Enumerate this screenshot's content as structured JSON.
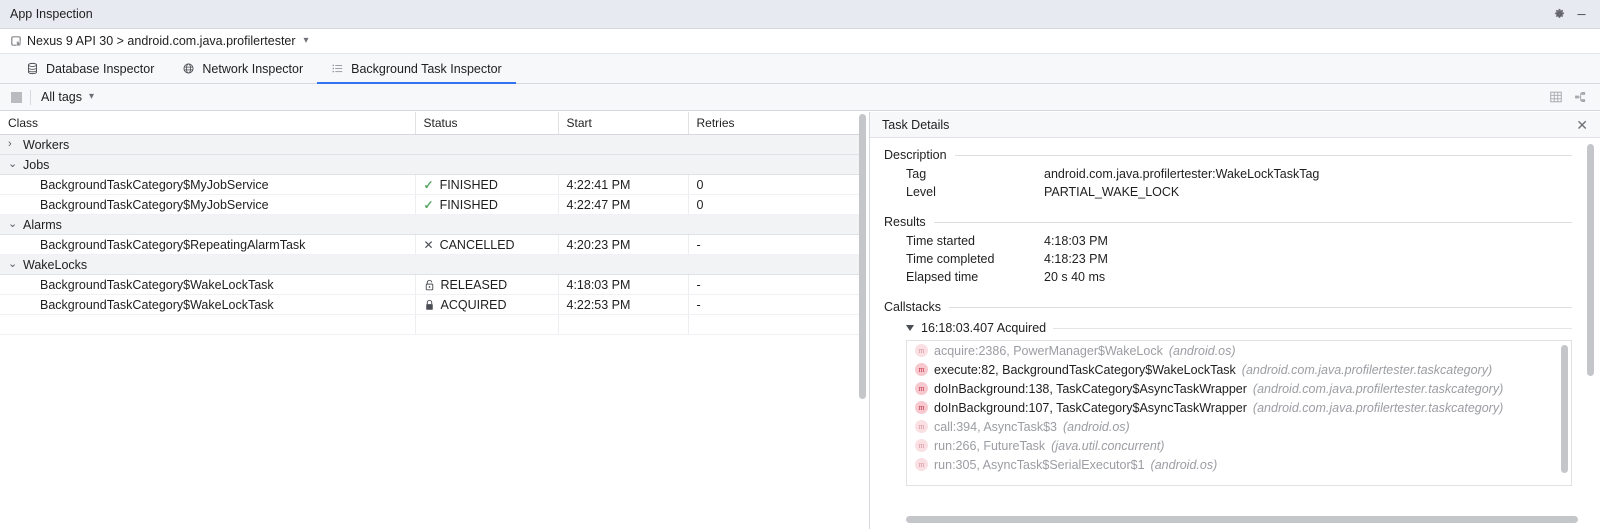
{
  "window": {
    "title": "App Inspection",
    "settings_icon": "gear-icon",
    "minimize_icon": "minimize-icon"
  },
  "device_bar": {
    "icon": "device-icon",
    "label": "Nexus 9 API 30 > android.com.java.profilertester",
    "dropdown_icon": "chevron-down-icon"
  },
  "tabs": [
    {
      "label": "Database Inspector",
      "icon": "database-icon",
      "active": false
    },
    {
      "label": "Network Inspector",
      "icon": "globe-icon",
      "active": false
    },
    {
      "label": "Background Task Inspector",
      "icon": "list-icon",
      "active": true
    }
  ],
  "toolbar": {
    "stop_button": "stop-button",
    "tags_filter_label": "All tags",
    "tags_dropdown_icon": "chevron-down-icon",
    "table_view_icon": "table-view-icon",
    "graph_view_icon": "graph-view-icon"
  },
  "table": {
    "columns": [
      "Class",
      "Status",
      "Start",
      "Retries"
    ],
    "groups": [
      {
        "name": "Workers",
        "expanded": false,
        "chevron": "›",
        "rows": []
      },
      {
        "name": "Jobs",
        "expanded": true,
        "chevron": "⌄",
        "rows": [
          {
            "class": "BackgroundTaskCategory$MyJobService",
            "status": "FINISHED",
            "status_icon": "check-icon",
            "start": "4:22:41 PM",
            "retries": "0"
          },
          {
            "class": "BackgroundTaskCategory$MyJobService",
            "status": "FINISHED",
            "status_icon": "check-icon",
            "start": "4:22:47 PM",
            "retries": "0"
          }
        ]
      },
      {
        "name": "Alarms",
        "expanded": true,
        "chevron": "⌄",
        "rows": [
          {
            "class": "BackgroundTaskCategory$RepeatingAlarmTask",
            "status": "CANCELLED",
            "status_icon": "x-icon",
            "start": "4:20:23 PM",
            "retries": "-"
          }
        ]
      },
      {
        "name": "WakeLocks",
        "expanded": true,
        "chevron": "⌄",
        "rows": [
          {
            "class": "BackgroundTaskCategory$WakeLockTask",
            "status": "RELEASED",
            "status_icon": "unlock-icon",
            "start": "4:18:03 PM",
            "retries": "-"
          },
          {
            "class": "BackgroundTaskCategory$WakeLockTask",
            "status": "ACQUIRED",
            "status_icon": "lock-icon",
            "start": "4:22:53 PM",
            "retries": "-"
          }
        ]
      }
    ]
  },
  "details": {
    "header": "Task Details",
    "close_icon": "close-icon",
    "description": {
      "title": "Description",
      "fields": [
        {
          "key": "Tag",
          "value": "android.com.java.profilertester:WakeLockTaskTag"
        },
        {
          "key": "Level",
          "value": "PARTIAL_WAKE_LOCK"
        }
      ]
    },
    "results": {
      "title": "Results",
      "fields": [
        {
          "key": "Time started",
          "value": "4:18:03 PM"
        },
        {
          "key": "Time completed",
          "value": "4:18:23 PM"
        },
        {
          "key": "Elapsed time",
          "value": "20 s 40 ms"
        }
      ]
    },
    "callstacks": {
      "title": "Callstacks",
      "node": {
        "label": "16:18:03.407 Acquired",
        "expanded": true,
        "icon": "triangle-down-icon"
      },
      "frames": [
        {
          "icon": "method-icon",
          "name": "acquire:2386, PowerManager$WakeLock",
          "package": "(android.os)",
          "dim": true
        },
        {
          "icon": "method-icon",
          "name": "execute:82, BackgroundTaskCategory$WakeLockTask",
          "package": "(android.com.java.profilertester.taskcategory)",
          "dim": false
        },
        {
          "icon": "method-icon",
          "name": "doInBackground:138, TaskCategory$AsyncTaskWrapper",
          "package": "(android.com.java.profilertester.taskcategory)",
          "dim": false
        },
        {
          "icon": "method-icon",
          "name": "doInBackground:107, TaskCategory$AsyncTaskWrapper",
          "package": "(android.com.java.profilertester.taskcategory)",
          "dim": false
        },
        {
          "icon": "method-icon",
          "name": "call:394, AsyncTask$3",
          "package": "(android.os)",
          "dim": true
        },
        {
          "icon": "method-icon",
          "name": "run:266, FutureTask",
          "package": "(java.util.concurrent)",
          "dim": true
        },
        {
          "icon": "method-icon",
          "name": "run:305, AsyncTask$SerialExecutor$1",
          "package": "(android.os)",
          "dim": true
        }
      ]
    }
  },
  "colors": {
    "accent": "#3574f0",
    "success": "#59a869",
    "titlebar_bg": "#e8eaf2",
    "panel_bg": "#f7f8fa",
    "group_row_bg": "#f2f3f5"
  }
}
